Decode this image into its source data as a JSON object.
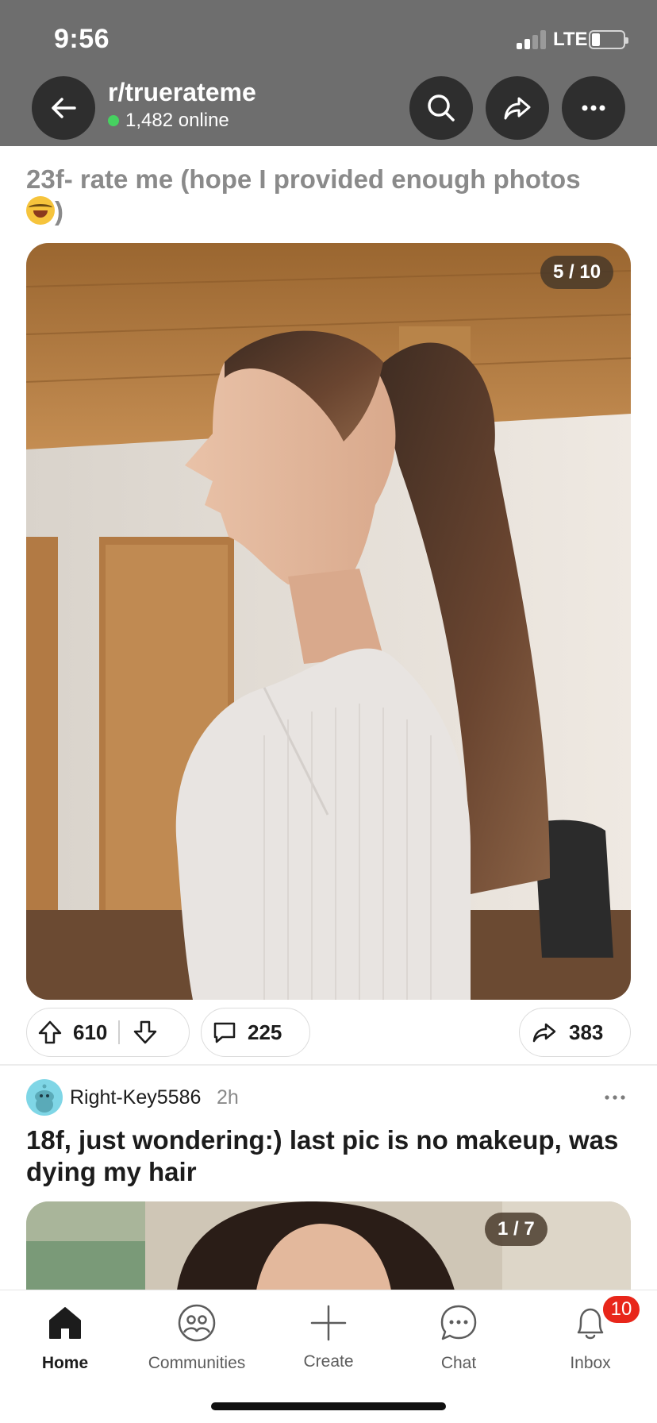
{
  "status_bar": {
    "time": "9:56",
    "network": "LTE",
    "battery_level": 0.25
  },
  "header": {
    "subreddit": "r/truerateme",
    "online": "1,482 online",
    "icons": [
      "back-arrow-icon",
      "search-icon",
      "share-icon",
      "more-icon"
    ]
  },
  "post1": {
    "title": "23f- rate me (hope I provided enough photos",
    "title_end": ")",
    "emoji": "tears-of-joy-emoji",
    "image_counter": "5 / 10",
    "upvotes": "610",
    "comments": "225",
    "shares": "383"
  },
  "post2": {
    "author": "Right-Key5586",
    "age": "2h",
    "title": "18f, just wondering:) last pic is no makeup, was dying my hair",
    "image_counter": "1 / 7"
  },
  "bottom_nav": {
    "items": [
      {
        "label": "Home",
        "icon": "home-icon",
        "active": true
      },
      {
        "label": "Communities",
        "icon": "communities-icon",
        "active": false
      },
      {
        "label": "Create",
        "icon": "plus-icon",
        "active": false
      },
      {
        "label": "Chat",
        "icon": "chat-icon",
        "active": false
      },
      {
        "label": "Inbox",
        "icon": "bell-icon",
        "active": false
      }
    ],
    "inbox_badge": "10"
  },
  "colors": {
    "header_overlay": "#6e6e6e",
    "online_dot": "#46d160",
    "badge": "#e8261a"
  }
}
